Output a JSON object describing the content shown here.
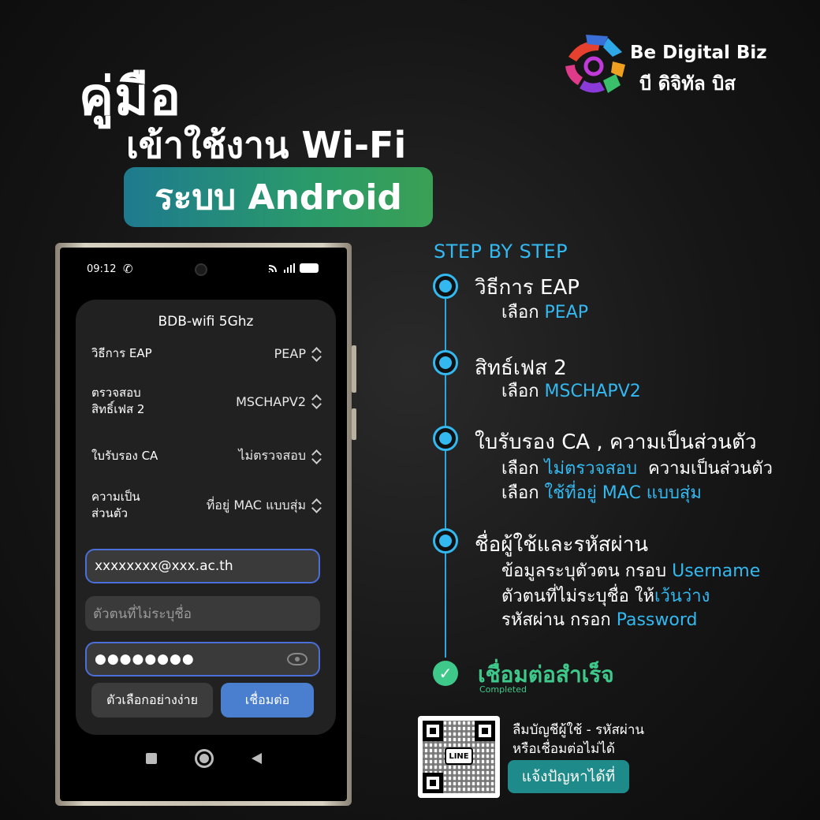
{
  "header": {
    "title_line1": "คู่มือ",
    "title_line2": "เข้าใช้งาน Wi-Fi",
    "badge": "ระบบ Android"
  },
  "brand": {
    "name_en": "Be Digital Biz",
    "name_th": "บี ดิจิทัล บิส"
  },
  "phone": {
    "status_time": "09:12",
    "dialog_title": "BDB-wifi 5Ghz",
    "rows": [
      {
        "label": "วิธีการ EAP",
        "value": "PEAP"
      },
      {
        "label": "ตรวจสอบ\nสิทธิ์เฟส 2",
        "value": "MSCHAPV2"
      },
      {
        "label": "ใบรับรอง CA",
        "value": "ไม่ตรวจสอบ"
      },
      {
        "label": "ความเป็น\nส่วนตัว",
        "value": "ที่อยู่ MAC แบบสุ่ม"
      }
    ],
    "identity_value": "xxxxxxxx@xxx.ac.th",
    "anonymous_placeholder": "ตัวตนที่ไม่ระบุชื่อ",
    "password_masked": "●●●●●●●●",
    "btn_simple_options": "ตัวเลือกอย่างง่าย",
    "btn_connect": "เชื่อมต่อ"
  },
  "steps": {
    "heading": "STEP BY STEP",
    "items": [
      {
        "title": "วิธีการ EAP",
        "lines": [
          {
            "prefix": "เลือก ",
            "highlight": "PEAP",
            "suffix": ""
          }
        ]
      },
      {
        "title": "สิทธ์เฟส 2",
        "lines": [
          {
            "prefix": "เลือก ",
            "highlight": "MSCHAPV2",
            "suffix": ""
          }
        ]
      },
      {
        "title": "ใบรับรอง CA , ความเป็นส่วนตัว",
        "lines": [
          {
            "prefix": "เลือก ",
            "highlight": "ไม่ตรวจสอบ",
            "suffix": "  ความเป็นส่วนตัว"
          },
          {
            "prefix": "เลือก ",
            "highlight": "ใช้ที่อยู่ MAC แบบสุ่ม",
            "suffix": ""
          }
        ]
      },
      {
        "title": "ชื่อผู้ใช้และรหัสผ่าน",
        "lines": [
          {
            "prefix": "ข้อมูลระบุตัวตน กรอบ ",
            "highlight": "Username",
            "suffix": ""
          },
          {
            "prefix": "ตัวตนที่ไม่ระบุชื่อ ให้",
            "highlight": "เว้นว่าง",
            "suffix": ""
          },
          {
            "prefix": "รหัสผ่าน กรอก ",
            "highlight": "Password",
            "suffix": ""
          }
        ]
      }
    ],
    "done_title": "เชื่อมต่อสำเร็จ",
    "done_sub": "Completed"
  },
  "help": {
    "qr_label": "LINE",
    "line1": "ลืมบัญชีผู้ใช้ - รหัสผ่าน",
    "line2": "หรือเชื่อมต่อไม่ได้",
    "button": "แจ้งปัญหาได้ที่"
  },
  "colors": {
    "accent_blue": "#33b8f0",
    "success_green": "#3ec98a",
    "connect_button": "#4a7fd0"
  }
}
